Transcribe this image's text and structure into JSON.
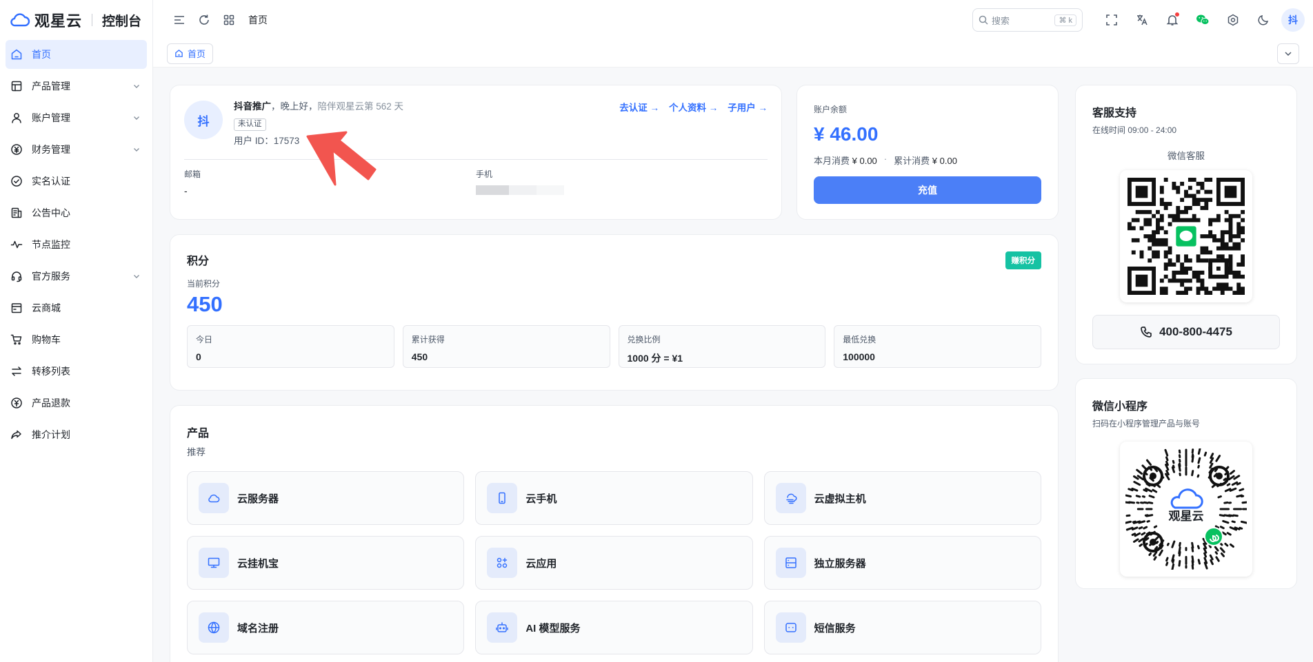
{
  "app": {
    "brand": "观星云",
    "subtitle": "控制台"
  },
  "sidebar": {
    "items": [
      {
        "label": "首页",
        "icon": "home-icon",
        "active": true,
        "expandable": false
      },
      {
        "label": "产品管理",
        "icon": "product-icon",
        "expandable": true
      },
      {
        "label": "账户管理",
        "icon": "user-icon",
        "expandable": true
      },
      {
        "label": "财务管理",
        "icon": "yuan-icon",
        "expandable": true
      },
      {
        "label": "实名认证",
        "icon": "check-circle-icon",
        "expandable": false
      },
      {
        "label": "公告中心",
        "icon": "announcement-icon",
        "expandable": false
      },
      {
        "label": "节点监控",
        "icon": "pulse-icon",
        "expandable": false
      },
      {
        "label": "官方服务",
        "icon": "headset-icon",
        "expandable": true
      },
      {
        "label": "云商城",
        "icon": "store-icon",
        "expandable": false
      },
      {
        "label": "购物车",
        "icon": "cart-icon",
        "expandable": false
      },
      {
        "label": "转移列表",
        "icon": "transfer-icon",
        "expandable": false
      },
      {
        "label": "产品退款",
        "icon": "refund-icon",
        "expandable": false
      },
      {
        "label": "推介计划",
        "icon": "share-icon",
        "expandable": false
      }
    ]
  },
  "header": {
    "breadcrumb": "首页",
    "search": {
      "placeholder": "搜索",
      "shortcut": "⌘ k"
    },
    "avatar_text": "抖"
  },
  "tabs": [
    {
      "label": "首页"
    }
  ],
  "profile": {
    "avatar_text": "抖",
    "name": "抖音推广",
    "greeting": "，晚上好，",
    "companion": "陪伴观星云第 562 天",
    "status_badge": "未认证",
    "user_id": "用户 ID：17573",
    "links": {
      "verify": "去认证 →",
      "profile": "个人资料 →",
      "subusers": "子用户 →"
    },
    "email_label": "邮箱",
    "email_value": "-",
    "phone_label": "手机"
  },
  "balance": {
    "label": "账户余额",
    "amount": "¥ 46.00",
    "month_label": "本月消费",
    "month_value": "¥ 0.00",
    "separator": "·",
    "total_label": "累计消费",
    "total_value": "¥ 0.00",
    "recharge_label": "充值"
  },
  "points": {
    "title": "积分",
    "earn_label": "赚积分",
    "current_label": "当前积分",
    "current_value": "450",
    "stats": [
      {
        "label": "今日",
        "value": "0"
      },
      {
        "label": "累计获得",
        "value": "450"
      },
      {
        "label": "兑换比例",
        "value": "1000 分 = ¥1"
      },
      {
        "label": "最低兑换",
        "value": "100000"
      }
    ]
  },
  "products": {
    "title": "产品",
    "subtitle": "推荐",
    "items": [
      {
        "label": "云服务器",
        "icon": "cloud-icon"
      },
      {
        "label": "云手机",
        "icon": "phone-icon"
      },
      {
        "label": "云虚拟主机",
        "icon": "cloud-host-icon"
      },
      {
        "label": "云挂机宝",
        "icon": "monitor-icon"
      },
      {
        "label": "云应用",
        "icon": "apps-icon"
      },
      {
        "label": "独立服务器",
        "icon": "server-icon"
      },
      {
        "label": "域名注册",
        "icon": "globe-icon"
      },
      {
        "label": "AI 模型服务",
        "icon": "robot-icon"
      },
      {
        "label": "短信服务",
        "icon": "message-icon"
      }
    ]
  },
  "support": {
    "title": "客服支持",
    "hours": "在线时间 09:00 - 24:00",
    "qr_caption": "微信客服",
    "phone": "400-800-4475"
  },
  "mini_program": {
    "title": "微信小程序",
    "subtitle": "扫码在小程序管理产品与账号",
    "logo_text": "观星云"
  },
  "colors": {
    "accent": "#3370FF",
    "primary_button": "#4B7FF7",
    "earn_badge": "#16C2A3",
    "wechat": "#07C160",
    "annotation_arrow": "#F2554F"
  }
}
